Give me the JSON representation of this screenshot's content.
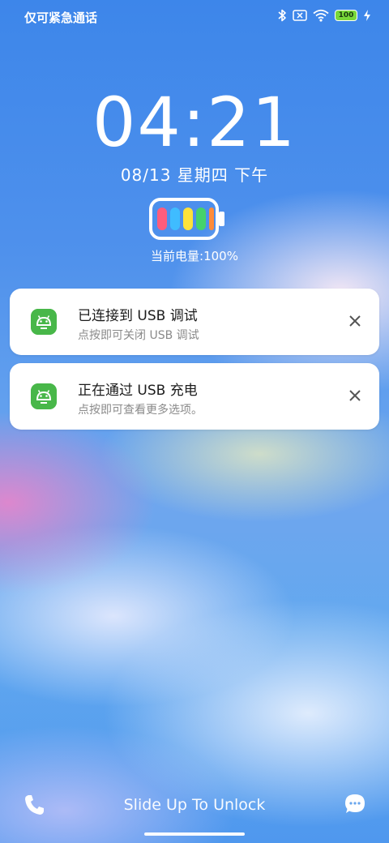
{
  "status_bar": {
    "carrier": "仅可紧急通话",
    "battery_level": "100",
    "icons": [
      "bluetooth-icon",
      "no-sim-icon",
      "wifi-icon",
      "battery-icon",
      "charging-icon"
    ]
  },
  "lock": {
    "time": "04:21",
    "date": "08/13 星期四 下午",
    "battery_status": "当前电量:100%",
    "battery_colors": [
      "#ff5c7c",
      "#3fbcff",
      "#ffe23a",
      "#45d26b",
      "#ff8c3a"
    ]
  },
  "notifications": [
    {
      "title": "已连接到 USB 调试",
      "subtitle": "点按即可关闭 USB 调试"
    },
    {
      "title": "正在通过 USB 充电",
      "subtitle": "点按即可查看更多选项。"
    }
  ],
  "bottom": {
    "slide_text": "Slide Up To Unlock"
  },
  "colors": {
    "app_icon": "#48b749",
    "battery_small_fill": "#79d83a"
  }
}
